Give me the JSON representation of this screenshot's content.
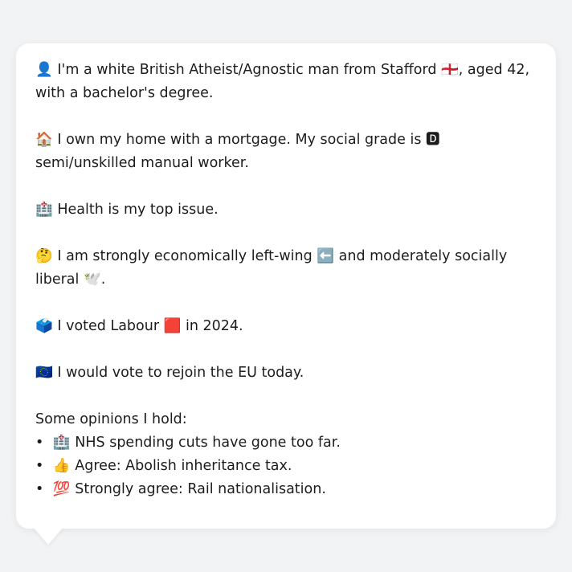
{
  "persona": {
    "identity_emoji": "👤",
    "identity_text": "I'm a white British Atheist/Agnostic man from Stafford 🏴󠁧󠁢󠁥󠁮󠁧󠁿, aged 42, with a bachelor's degree.",
    "home_emoji": "🏠",
    "home_text": "I own my home with a mortgage. My social grade is 🅳 semi/unskilled manual worker.",
    "issue_emoji": "🏥",
    "issue_text": "Health is my top issue.",
    "ideology_emoji": "🤔",
    "ideology_text": "I am strongly economically left-wing ⬅️ and moderately socially liberal 🕊️.",
    "vote_emoji": "🗳️",
    "vote_text": "I voted Labour 🟥 in 2024.",
    "eu_emoji": "🇪🇺",
    "eu_text": "I would vote to rejoin the EU today."
  },
  "opinions": {
    "heading": "Some opinions I hold:",
    "items": [
      {
        "emoji": "🏥",
        "text": "NHS spending cuts have gone too far."
      },
      {
        "emoji": "👍",
        "text": "Agree: Abolish inheritance tax."
      },
      {
        "emoji": "💯",
        "text": "Strongly agree: Rail nationalisation."
      }
    ]
  }
}
